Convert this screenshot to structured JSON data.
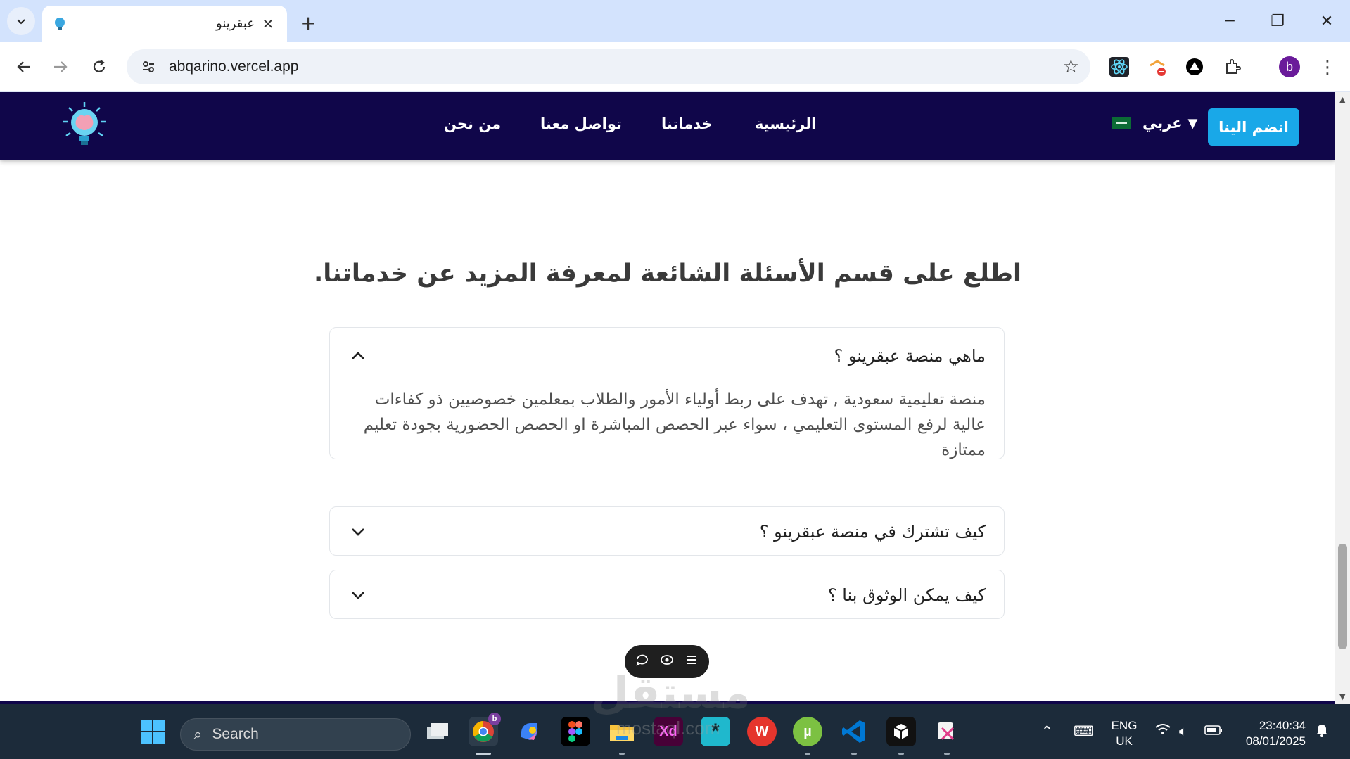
{
  "browser": {
    "tab_title": "عبقرينو",
    "tab_close": "✕",
    "new_tab": "+",
    "url": "abqarino.vercel.app",
    "window_controls": {
      "minimize": "─",
      "restore": "❐",
      "close": "✕"
    },
    "profile_initial": "b"
  },
  "site": {
    "nav": {
      "links": [
        "الرئيسية",
        "خدماتنا",
        "تواصل معنا",
        "من نحن"
      ],
      "language": "عربي",
      "language_arrow": "▼",
      "join_button": "انضم الينا"
    },
    "faq_heading": "اطلع على قسم الأسئلة الشائعة لمعرفة المزيد عن خدماتنا.",
    "faq": [
      {
        "question": "ماهي منصة عبقرينو ؟",
        "answer": "منصة تعليمية سعودية , تهدف على ربط أولياء الأمور والطلاب بمعلمين خصوصيين ذو كفاءات عالية لرفع المستوى التعليمي ، سواء عبر الحصص المباشرة او الحصص الحضورية بجودة تعليم ممتازة",
        "expanded": true
      },
      {
        "question": "كيف تشترك في منصة عبقرينو ؟",
        "expanded": false
      },
      {
        "question": "كيف يمكن الوثوق بنا ؟",
        "expanded": false
      }
    ]
  },
  "taskbar": {
    "search_placeholder": "Search",
    "language_line1": "ENG",
    "language_line2": "UK",
    "time": "23:40:34",
    "date": "08/01/2025",
    "chrome_badge": "b",
    "apps": [
      "start-icon",
      "task-view-icon",
      "chrome-icon",
      "copilot-icon",
      "figma-icon",
      "file-explorer-icon",
      "adobe-xd-icon",
      "perplexity-icon",
      "wps-office-icon",
      "utorrent-icon",
      "vscode-icon",
      "cube-app-icon",
      "snipping-tool-icon"
    ]
  },
  "watermark": {
    "arabic": "مستقل",
    "latin": "mostaql.com"
  },
  "colors": {
    "site_nav_bg": "#10064a",
    "join_button_bg": "#19a8e8",
    "taskbar_bg": "#1c2b3a",
    "tabstrip_bg": "#d3e3fd"
  }
}
